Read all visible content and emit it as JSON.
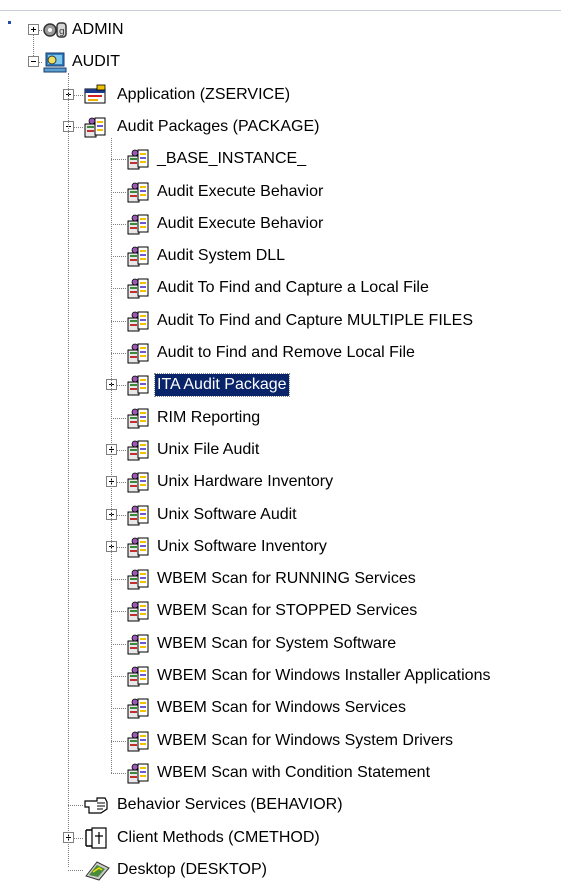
{
  "tree": {
    "admin": {
      "label": "ADMIN",
      "icon": "admin-gears-icon",
      "expander": "plus"
    },
    "audit": {
      "label": "AUDIT",
      "icon": "audit-computer-icon",
      "expander": "minus"
    },
    "application": {
      "label": "Application (ZSERVICE)",
      "icon": "application-icon",
      "expander": "plus"
    },
    "audit_packages": {
      "label": "Audit Packages (PACKAGE)",
      "icon": "package-icon",
      "expander": "minus"
    },
    "packages": [
      {
        "label": "_BASE_INSTANCE_",
        "expander": "none"
      },
      {
        "label": "Audit Execute Behavior",
        "expander": "none"
      },
      {
        "label": "Audit Execute Behavior",
        "expander": "none"
      },
      {
        "label": "Audit System DLL",
        "expander": "none"
      },
      {
        "label": "Audit To Find and Capture a Local File",
        "expander": "none"
      },
      {
        "label": "Audit To Find and Capture MULTIPLE FILES",
        "expander": "none"
      },
      {
        "label": "Audit to Find and Remove Local File",
        "expander": "none"
      },
      {
        "label": "ITA Audit Package",
        "expander": "plus",
        "selected": true
      },
      {
        "label": "RIM Reporting",
        "expander": "none"
      },
      {
        "label": "Unix File Audit",
        "expander": "plus"
      },
      {
        "label": "Unix Hardware Inventory",
        "expander": "plus"
      },
      {
        "label": "Unix Software Audit",
        "expander": "plus"
      },
      {
        "label": "Unix Software Inventory",
        "expander": "plus"
      },
      {
        "label": "WBEM Scan for RUNNING Services",
        "expander": "none"
      },
      {
        "label": "WBEM Scan for STOPPED Services",
        "expander": "none"
      },
      {
        "label": "WBEM Scan for System Software",
        "expander": "none"
      },
      {
        "label": "WBEM Scan for Windows Installer Applications",
        "expander": "none"
      },
      {
        "label": "WBEM Scan for Windows Services",
        "expander": "none"
      },
      {
        "label": "WBEM Scan for Windows System Drivers",
        "expander": "none"
      },
      {
        "label": "WBEM Scan with Condition Statement",
        "expander": "none"
      }
    ],
    "behavior_services": {
      "label": "Behavior Services (BEHAVIOR)",
      "icon": "behavior-hand-icon",
      "expander": "none"
    },
    "client_methods": {
      "label": "Client Methods (CMETHOD)",
      "icon": "client-methods-icon",
      "expander": "plus"
    },
    "desktop": {
      "label": "Desktop (DESKTOP)",
      "icon": "desktop-icon",
      "expander": "none"
    }
  },
  "colors": {
    "selection_bg": "#0a246a",
    "selection_text": "#ffffff",
    "tree_line": "#808080",
    "background": "#ffffff"
  }
}
